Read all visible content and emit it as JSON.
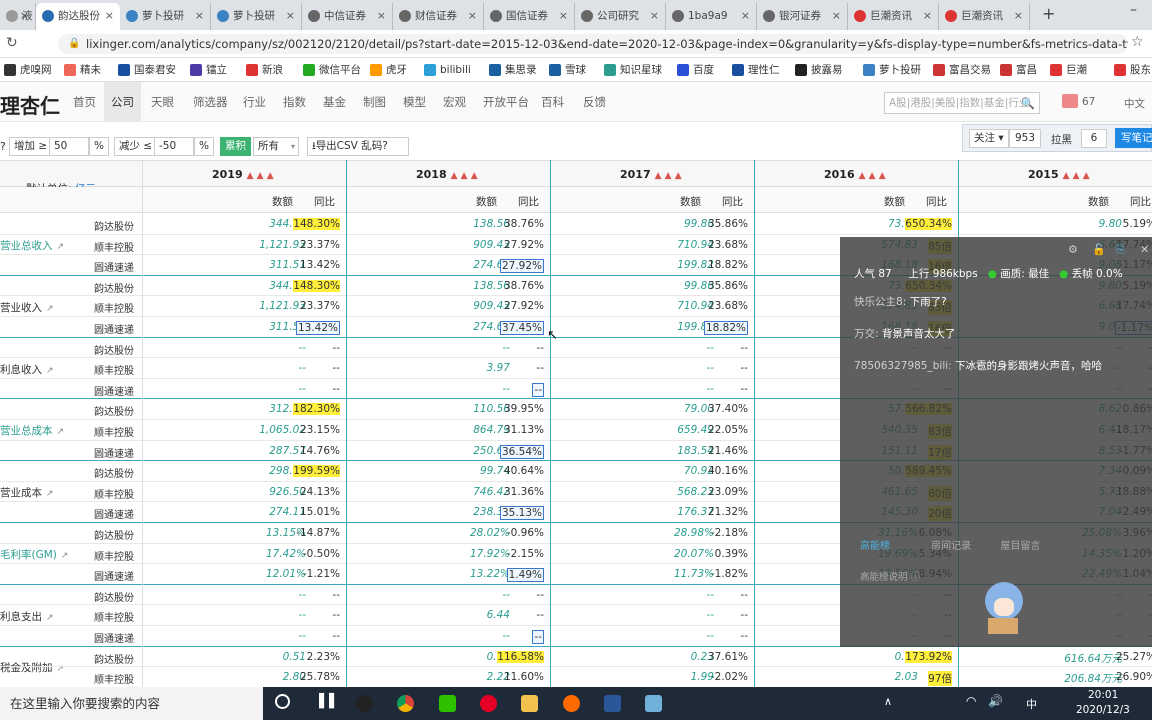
{
  "browser": {
    "tabs": [
      {
        "label": "液",
        "color": "#999"
      },
      {
        "label": "韵达股份",
        "color": "#2b6cb0"
      },
      {
        "label": "萝卜投研",
        "color": "#3b82c4"
      },
      {
        "label": "萝卜投研",
        "color": "#3b82c4"
      },
      {
        "label": "中信证券",
        "color": "#666"
      },
      {
        "label": "财信证券",
        "color": "#666"
      },
      {
        "label": "国信证券",
        "color": "#666"
      },
      {
        "label": "公司研究",
        "color": "#666"
      },
      {
        "label": "1ba9a9",
        "color": "#666"
      },
      {
        "label": "银河证券",
        "color": "#666"
      },
      {
        "label": "巨潮资讯",
        "color": "#d33"
      },
      {
        "label": "巨潮资讯",
        "color": "#d33"
      }
    ],
    "url": "lixinger.com/analytics/company/sz/002120/2120/detail/ps?start-date=2015-12-03&end-date=2020-12-03&page-index=0&granularity=y&fs-display-type=number&fs-metrics-data-types=...",
    "bookmarks": [
      {
        "label": "虎嗅网",
        "color": "#333"
      },
      {
        "label": "精未",
        "color": "#e65"
      },
      {
        "label": "国泰君安",
        "color": "#1a4fa0"
      },
      {
        "label": "镭立",
        "color": "#4b3aa8"
      },
      {
        "label": "新浪",
        "color": "#d33"
      },
      {
        "label": "微信平台",
        "color": "#2a2"
      },
      {
        "label": "虎牙",
        "color": "#f90"
      },
      {
        "label": "bilibili",
        "color": "#2b9fd8"
      },
      {
        "label": "集思录",
        "color": "#1a5fa0"
      },
      {
        "label": "雪球",
        "color": "#1a5fa0"
      },
      {
        "label": "知识星球",
        "color": "#2a9d8f"
      },
      {
        "label": "百度",
        "color": "#2c4fd8"
      },
      {
        "label": "理性仁",
        "color": "#1a4fa0"
      },
      {
        "label": "披露易",
        "color": "#222"
      },
      {
        "label": "萝卜投研",
        "color": "#3b82c4"
      },
      {
        "label": "富昌交易",
        "color": "#c33"
      },
      {
        "label": "富昌",
        "color": "#c33"
      },
      {
        "label": "巨潮",
        "color": "#d33"
      },
      {
        "label": "股东",
        "color": "#d33"
      }
    ]
  },
  "site": {
    "logo": "理杏仁",
    "nav": [
      "首页",
      "公司",
      "天眼",
      "筛选器",
      "行业",
      "指数",
      "基金",
      "制图",
      "模型",
      "宏观",
      "开放平台",
      "百科",
      "反馈"
    ],
    "search_placeholder": "A股|港股|美股|指数|基金|行业",
    "user_count": "67",
    "lang": "中文"
  },
  "toolbar": {
    "increase_label": "增加 ≥",
    "increase_value": "50",
    "decrease_label": "减少 ≤",
    "decrease_value": "-50",
    "cumulative": "累积",
    "all": "所有",
    "export": "导出CSV 乱码?",
    "follow": "关注",
    "follow_count": "953",
    "block": "拉黑",
    "block_count": "6",
    "note": "写笔记"
  },
  "table": {
    "unit_label": "默认单位: ",
    "unit_value": "亿元",
    "years": [
      "2019",
      "2018",
      "2017",
      "2016",
      "2015"
    ],
    "col_value": "数额",
    "col_yoy": "同比",
    "metrics": [
      {
        "name": "营业总收入",
        "teal": true,
        "rows": [
          [
            "韵达股份",
            "344.04",
            "148.30%",
            "138.56",
            "38.76%",
            "99.86",
            "35.86%",
            "73.50",
            "650.34%",
            "9.80",
            "5.19%"
          ],
          [
            "顺丰控股",
            "1,121.93",
            "23.37%",
            "909.43",
            "27.92%",
            "710.94",
            "23.68%",
            "574.83",
            "85倍",
            "6.68",
            "-17.74%"
          ],
          [
            "圆通速递",
            "311.51",
            "13.42%",
            "274.65",
            "27.92%",
            "199.82",
            "18.82%",
            "168.18",
            "16倍",
            "9.08",
            "-1.17%"
          ]
        ]
      },
      {
        "name": "营业收入",
        "teal": false,
        "rows": [
          [
            "韵达股份",
            "344.04",
            "148.30%",
            "138.56",
            "38.76%",
            "99.86",
            "35.86%",
            "73.50",
            "650.34%",
            "9.80",
            "5.19%"
          ],
          [
            "顺丰控股",
            "1,121.93",
            "23.37%",
            "909.43",
            "27.92%",
            "710.94",
            "23.68%",
            "574.83",
            "85倍",
            "6.68",
            "-17.74%"
          ],
          [
            "圆通速递",
            "311.51",
            "13.42%",
            "274.65",
            "37.45%",
            "199.82",
            "18.82%",
            "168.18",
            "16倍",
            "9.08",
            "-1.17%"
          ]
        ]
      },
      {
        "name": "利息收入",
        "teal": false,
        "rows": [
          [
            "韵达股份",
            "--",
            "--",
            "--",
            "--",
            "--",
            "--",
            "--",
            "--",
            "--",
            "--"
          ],
          [
            "顺丰控股",
            "--",
            "--",
            "3.97",
            "--",
            "--",
            "--",
            "--",
            "--",
            "--",
            "--"
          ],
          [
            "圆通速递",
            "--",
            "--",
            "--",
            "--",
            "--",
            "--",
            "--",
            "--",
            "--",
            "--"
          ]
        ]
      },
      {
        "name": "营业总成本",
        "teal": true,
        "rows": [
          [
            "韵达股份",
            "312.11",
            "182.30%",
            "110.56",
            "39.95%",
            "79.00",
            "37.40%",
            "57.50",
            "566.82%",
            "8.62",
            "0.86%"
          ],
          [
            "顺丰控股",
            "1,065.02",
            "23.15%",
            "864.79",
            "31.13%",
            "659.49",
            "22.05%",
            "540.35",
            "83倍",
            "6.41",
            "-18.17%"
          ],
          [
            "圆通速递",
            "287.57",
            "14.76%",
            "250.60",
            "36.54%",
            "183.54",
            "21.46%",
            "151.11",
            "17倍",
            "8.53",
            "-1.77%"
          ]
        ]
      },
      {
        "name": "营业成本",
        "teal": false,
        "rows": [
          [
            "韵达股份",
            "298.80",
            "199.59%",
            "99.74",
            "40.64%",
            "70.92",
            "40.16%",
            "50.60",
            "589.45%",
            "7.34",
            "-0.09%"
          ],
          [
            "顺丰控股",
            "926.50",
            "24.13%",
            "746.42",
            "31.36%",
            "568.23",
            "23.09%",
            "461.65",
            "80倍",
            "5.73",
            "-18.88%"
          ],
          [
            "圆通速递",
            "274.11",
            "15.01%",
            "238.34",
            "35.13%",
            "176.37",
            "21.32%",
            "145.30",
            "20倍",
            "7.04",
            "-2.49%"
          ]
        ]
      },
      {
        "name": "毛利率(GM)",
        "teal": true,
        "rows": [
          [
            "韵达股份",
            "13.15%",
            "-14.87%",
            "28.02%",
            "-0.96%",
            "28.98%",
            "-2.18%",
            "31.16%",
            "6.08%",
            "25.08%",
            "3.96%"
          ],
          [
            "顺丰控股",
            "17.42%",
            "-0.50%",
            "17.92%",
            "-2.15%",
            "20.07%",
            "0.39%",
            "19.69%",
            "5.34%",
            "14.35%",
            "1.20%"
          ],
          [
            "圆通速递",
            "12.01%",
            "-1.21%",
            "13.22%",
            "1.49%",
            "11.73%",
            "-1.82%",
            "13.56%",
            "8.94%",
            "22.49%",
            "1.04%"
          ]
        ]
      },
      {
        "name": "利息支出",
        "teal": false,
        "rows": [
          [
            "韵达股份",
            "--",
            "--",
            "--",
            "--",
            "--",
            "--",
            "--",
            "--",
            "--",
            "--"
          ],
          [
            "顺丰控股",
            "--",
            "--",
            "6.44",
            "--",
            "--",
            "--",
            "--",
            "--",
            "--",
            "--"
          ],
          [
            "圆通速递",
            "--",
            "--",
            "--",
            "--",
            "--",
            "--",
            "--",
            "--",
            "--",
            "--"
          ]
        ]
      },
      {
        "name": "税金及附加",
        "teal": false,
        "rows": [
          [
            "韵达股份",
            "0.51",
            "2.23%",
            "0.50",
            "116.58%",
            "0.23",
            "37.61%",
            "0.17",
            "173.92%",
            "616.64万元",
            "25.27%"
          ],
          [
            "顺丰控股",
            "2.80",
            "25.78%",
            "2.22",
            "11.60%",
            "1.99",
            "-2.02%",
            "2.03",
            "97倍",
            "206.84万元",
            "26.90%"
          ]
        ]
      }
    ]
  },
  "stream_overlay": {
    "popularity_label": "人气",
    "popularity": "87",
    "upload_label": "上行",
    "upload": "986kbps",
    "quality_label": "画质: 最佳",
    "frame_label": "丢帧 0.0%",
    "comments": [
      {
        "user": "快乐公主8",
        "text": "下雨了?"
      },
      {
        "user": "万交",
        "text": "背景声音太大了"
      },
      {
        "user": "78506327985_bili",
        "text": "下冰雹的身影跟烤火声音，哈哈"
      }
    ],
    "tabs": [
      "高能榜",
      "房间记录",
      "屋目留言"
    ],
    "tip": "高能榜说明"
  },
  "taskbar": {
    "search_placeholder": "在这里输入你要搜索的内容",
    "time": "20:01",
    "date": "2020/12/3",
    "ime": "中"
  }
}
